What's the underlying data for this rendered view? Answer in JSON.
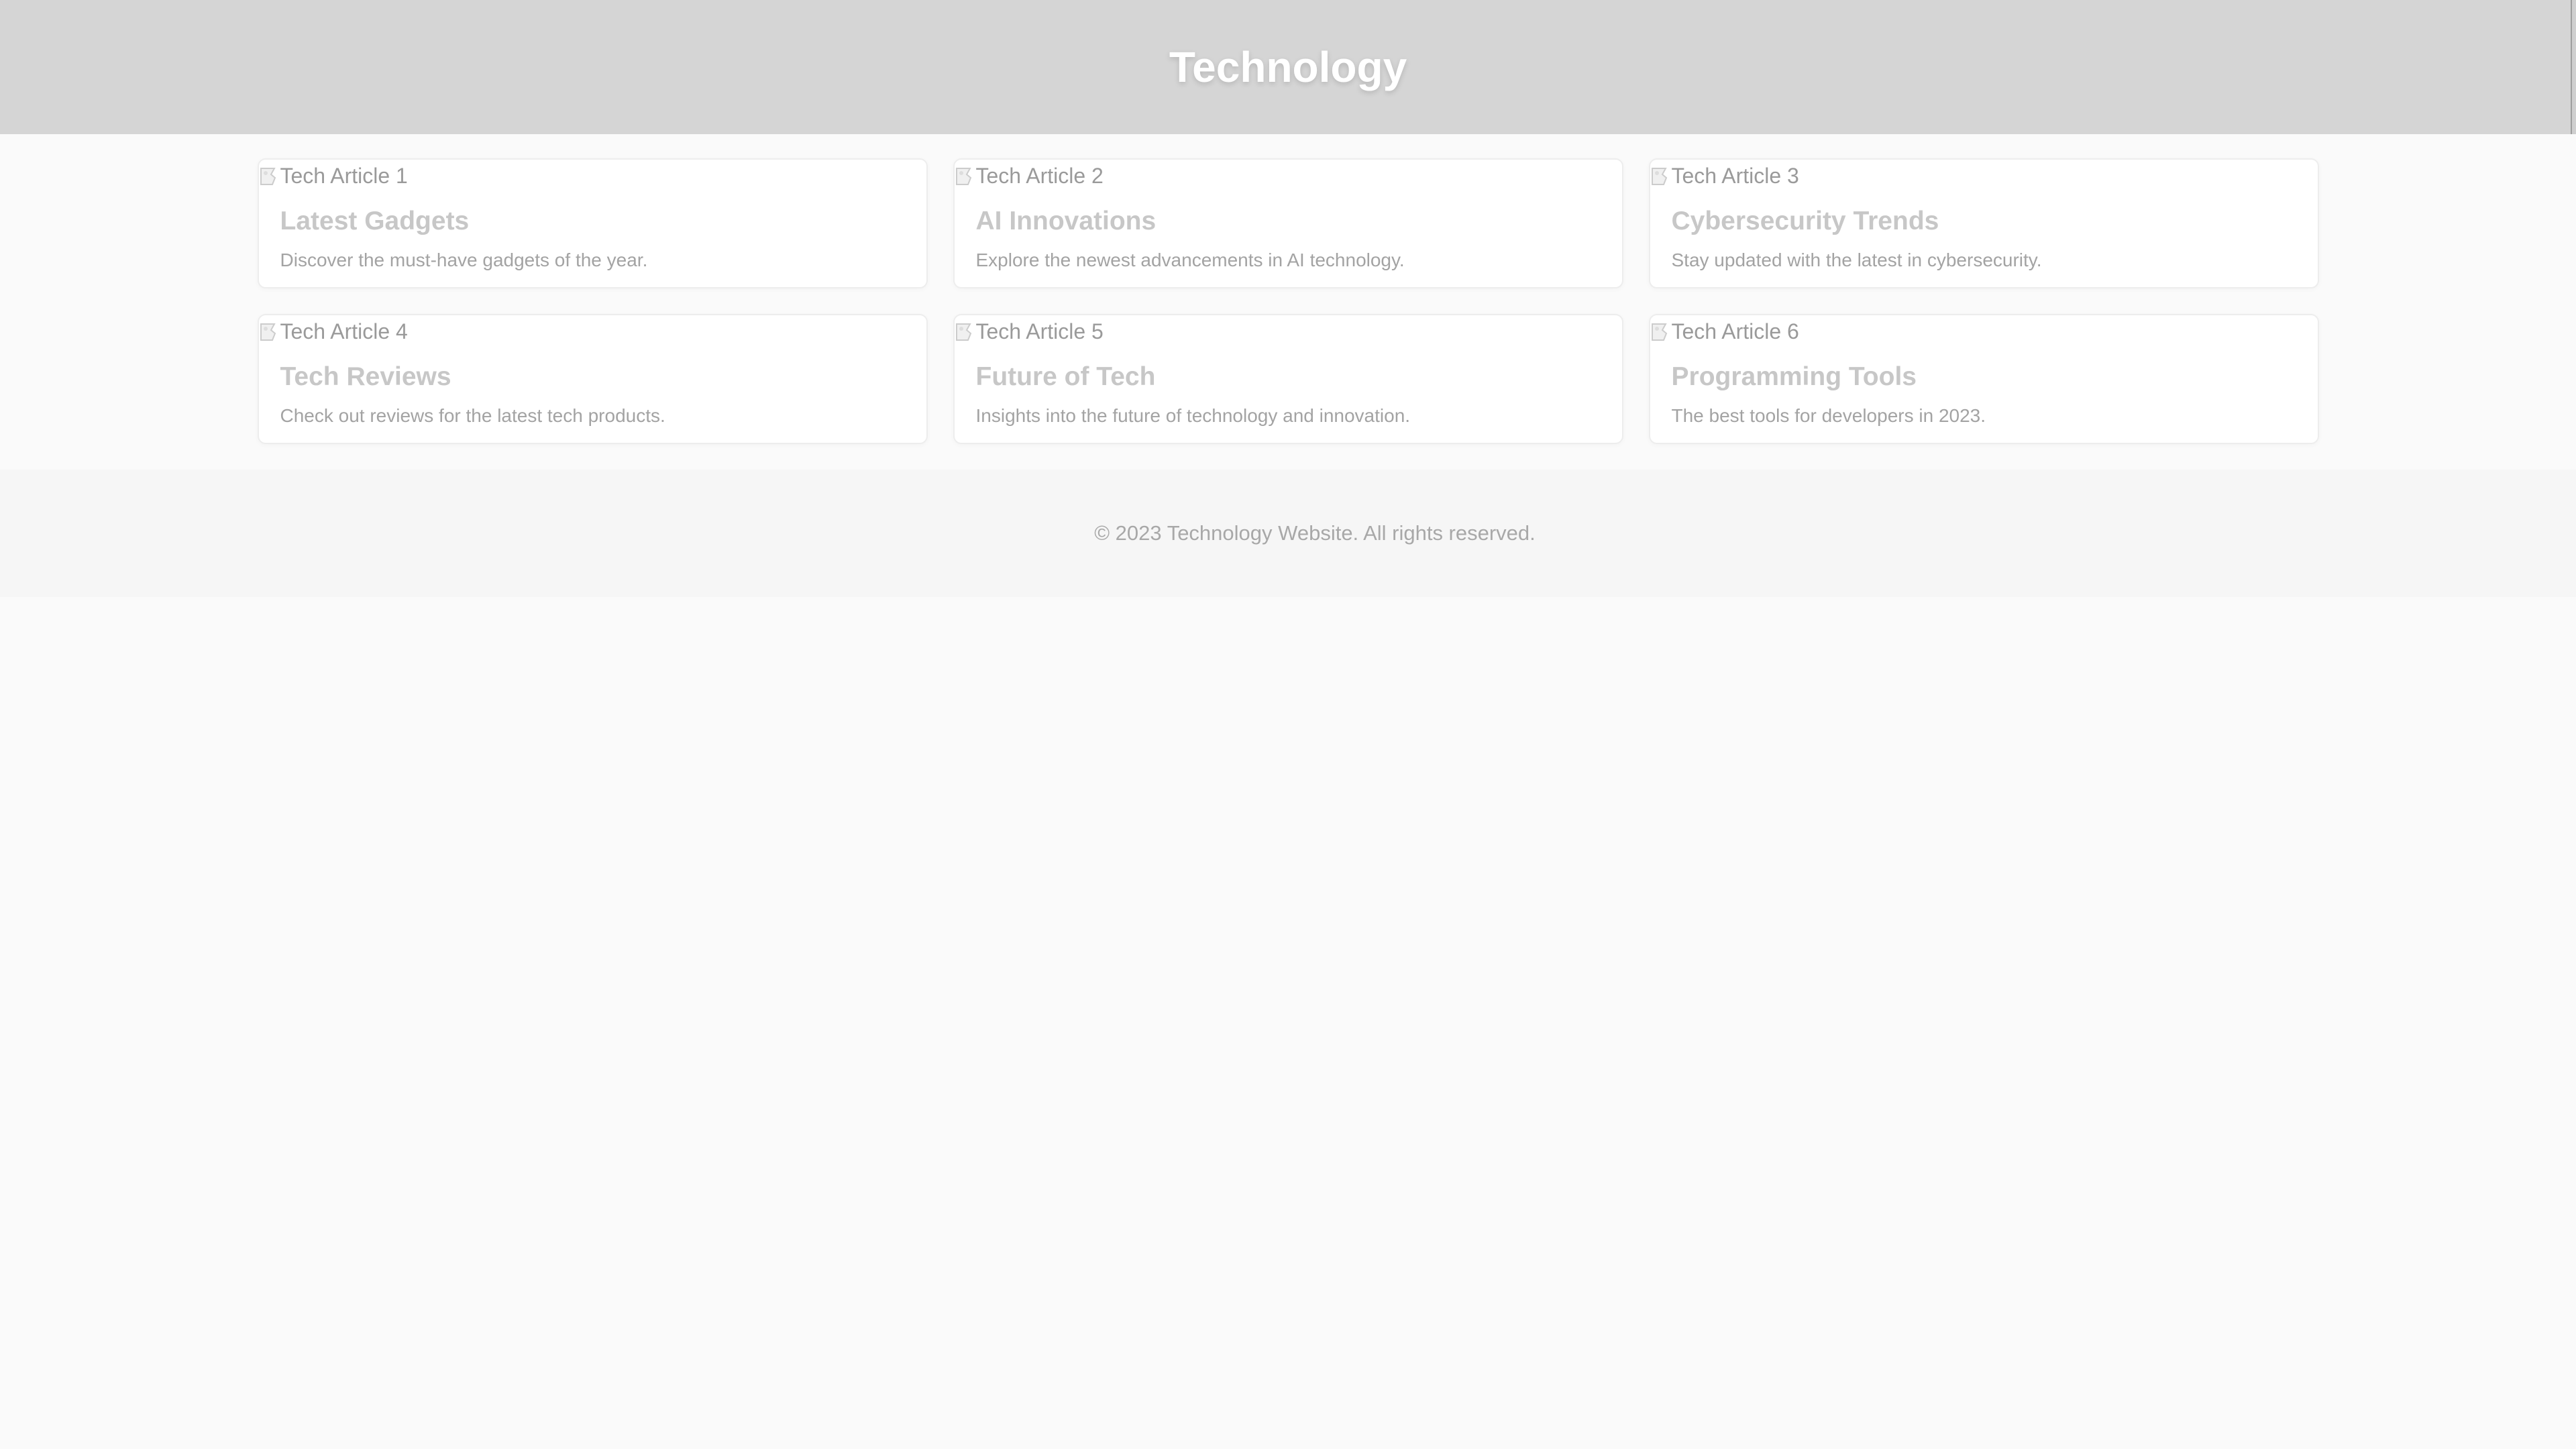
{
  "header": {
    "title": "Technology"
  },
  "articles": [
    {
      "image_alt": "Tech Article 1",
      "title": "Latest Gadgets",
      "description": "Discover the must-have gadgets of the year."
    },
    {
      "image_alt": "Tech Article 2",
      "title": "AI Innovations",
      "description": "Explore the newest advancements in AI technology."
    },
    {
      "image_alt": "Tech Article 3",
      "title": "Cybersecurity Trends",
      "description": "Stay updated with the latest in cybersecurity."
    },
    {
      "image_alt": "Tech Article 4",
      "title": "Tech Reviews",
      "description": "Check out reviews for the latest tech products."
    },
    {
      "image_alt": "Tech Article 5",
      "title": "Future of Tech",
      "description": "Insights into the future of technology and innovation."
    },
    {
      "image_alt": "Tech Article 6",
      "title": "Programming Tools",
      "description": "The best tools for developers in 2023."
    }
  ],
  "footer": {
    "copyright": "© 2023 Technology Website. All rights reserved."
  },
  "colors": {
    "header_bg": "#d5d5d5",
    "page_bg": "#fafafa",
    "footer_bg": "#f6f6f6",
    "title_text": "#ffffff"
  },
  "icons": {
    "article_image": "broken-image-icon"
  }
}
